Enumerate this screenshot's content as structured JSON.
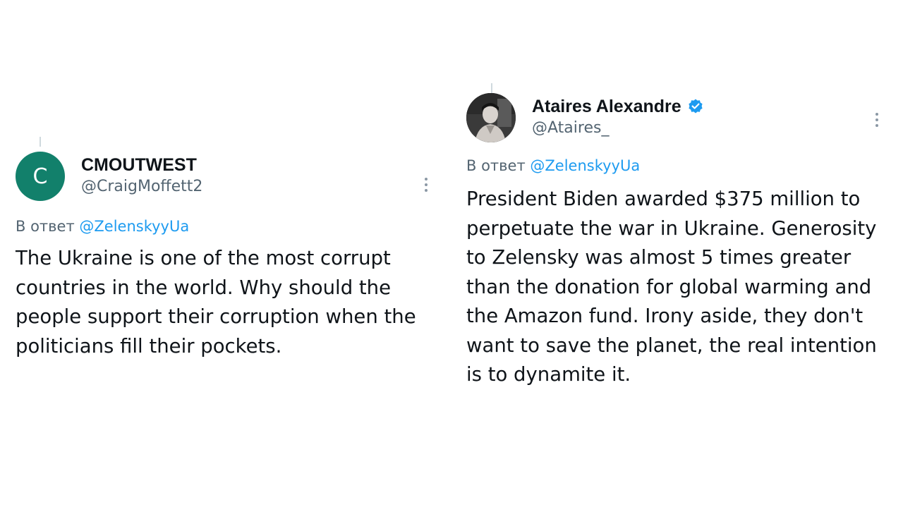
{
  "tweets": [
    {
      "avatar_letter": "C",
      "avatar_color": "#12806b",
      "display_name": "CMOUTWEST",
      "handle": "@CraigMoffett2",
      "verified": false,
      "reply_prefix": "В ответ",
      "reply_to": "@ZelenskyyUa",
      "text": "The Ukraine is one of the most corrupt countries in the world. Why should the people support their corruption when the politicians fill their pockets."
    },
    {
      "avatar_letter": "",
      "display_name": "Ataires Alexandre",
      "handle": "@Ataires_",
      "verified": true,
      "verified_color": "#1d9bf0",
      "reply_prefix": "В ответ",
      "reply_to": "@ZelenskyyUa",
      "text": "President Biden awarded $375 million to perpetuate the war in Ukraine. Generosity to Zelensky was almost 5 times greater than the donation for global warming and the Amazon fund. Irony aside, they don't want to save the planet, the real intention is to dynamite it."
    }
  ],
  "icons": {
    "more": "more-vertical-icon",
    "verified": "verified-badge-icon"
  }
}
